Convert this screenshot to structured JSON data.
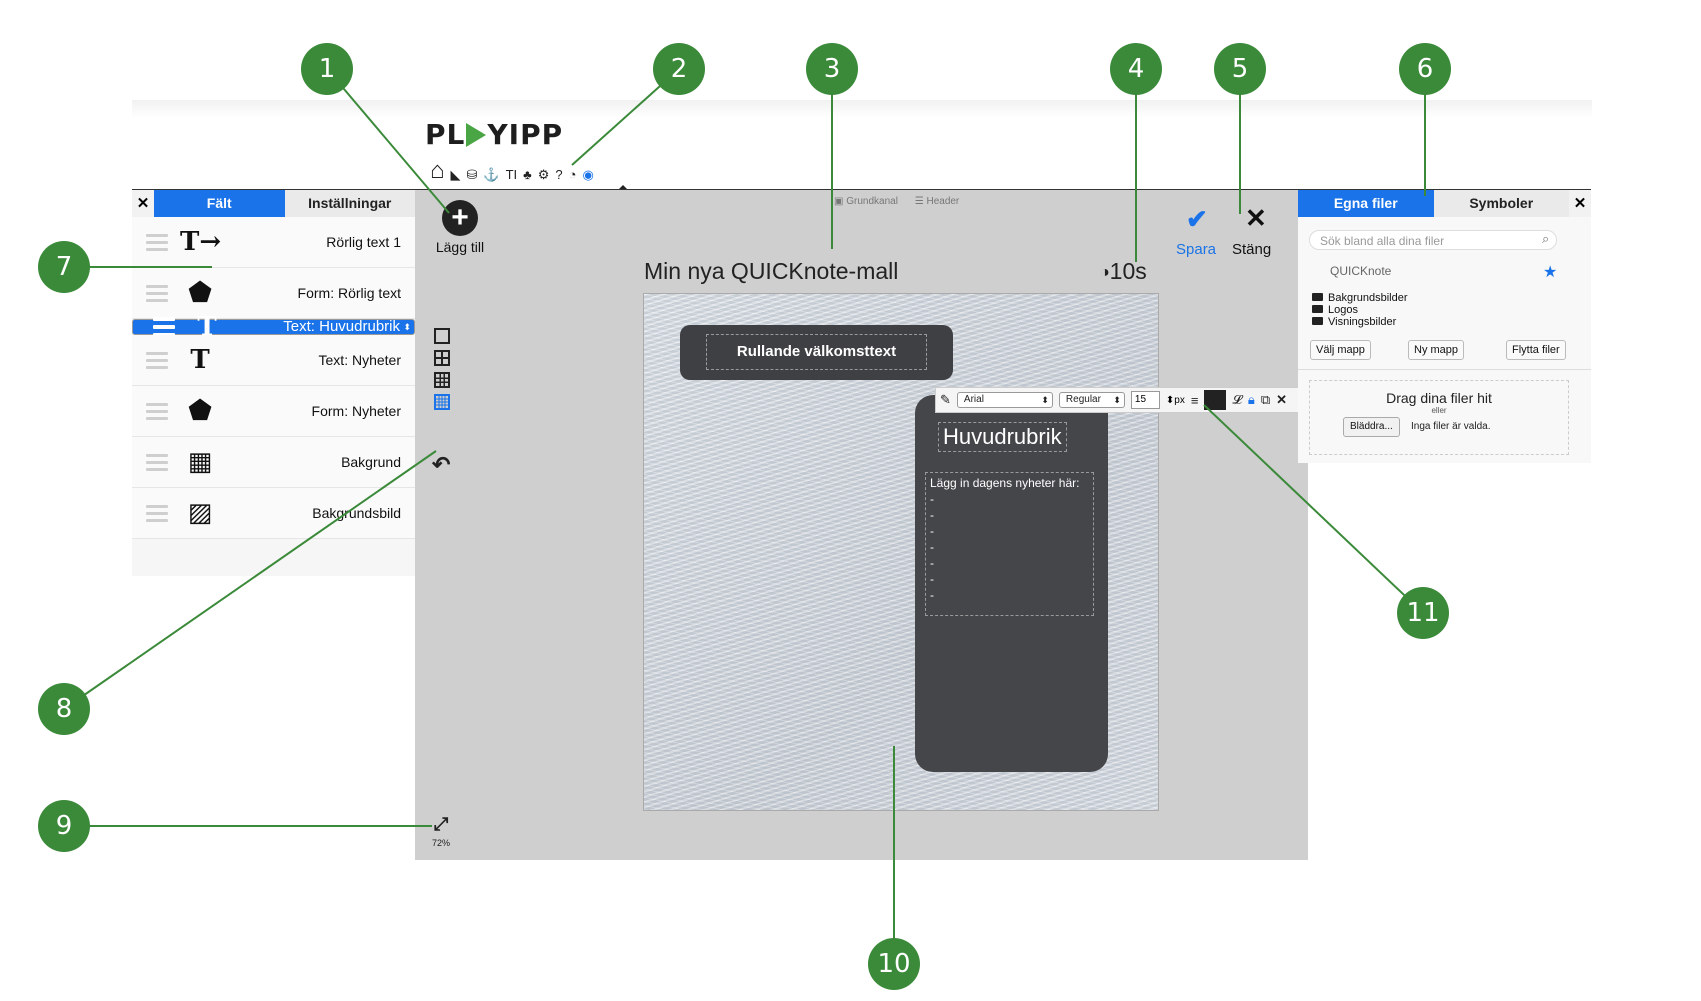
{
  "logo": {
    "left": "PL",
    "right": "YIPP"
  },
  "toolbar": {
    "add_label": "Lägg till",
    "crumb_1": "Grundkanal",
    "crumb_2": "Header",
    "template_name": "Min nya QUICKnote-mall",
    "duration": "10s",
    "save_label": "Spara",
    "close_label": "Stäng",
    "zoom": "72%"
  },
  "left_panel": {
    "close": "✕",
    "tabs": [
      {
        "label": "Fält",
        "active": true
      },
      {
        "label": "Inställningar",
        "active": false
      }
    ],
    "items": [
      {
        "label": "Rörlig text 1",
        "icon": "moving-text-icon",
        "glyph": "T→"
      },
      {
        "label": "Form: Rörlig text",
        "icon": "pentagon-icon",
        "glyph": "⬟"
      },
      {
        "label": "Text: Huvudrubrik",
        "icon": "text-icon",
        "glyph": "T",
        "selected": true
      },
      {
        "label": "Text: Nyheter",
        "icon": "text-icon",
        "glyph": "T"
      },
      {
        "label": "Form: Nyheter",
        "icon": "pentagon-icon",
        "glyph": "⬟"
      },
      {
        "label": "Bakgrund",
        "icon": "background-icon",
        "glyph": "▦"
      },
      {
        "label": "Bakgrundsbild",
        "icon": "image-icon",
        "glyph": "▨"
      }
    ]
  },
  "preview": {
    "ticker_text": "Rullande välkomsttext",
    "heading": "Huvudrubrik",
    "news_text": "Lägg in dagens nyheter här:",
    "bullets": [
      "-",
      "-",
      "-",
      "-",
      "-",
      "-",
      "-"
    ]
  },
  "format_bar": {
    "font": "Arial",
    "style": "Regular",
    "size": "15",
    "unit": "px",
    "color": "#222222"
  },
  "right_panel": {
    "tabs": [
      {
        "label": "Egna filer",
        "active": true
      },
      {
        "label": "Symboler",
        "active": false
      }
    ],
    "close": "✕",
    "search_placeholder": "Sök bland alla dina filer",
    "favorite": "QUICKnote",
    "folders": [
      "Bakgrundsbilder",
      "Logos",
      "Visningsbilder"
    ],
    "buttons": {
      "choose_folder": "Välj mapp",
      "new_folder": "Ny mapp",
      "move_files": "Flytta filer"
    },
    "drop_title": "Drag dina filer hit",
    "drop_or": "eller",
    "browse": "Bläddra...",
    "no_files": "Inga filer är valda."
  },
  "callouts": [
    "1",
    "2",
    "3",
    "4",
    "5",
    "6",
    "7",
    "8",
    "9",
    "10",
    "11"
  ],
  "colors": {
    "accent": "#1a73e8",
    "callout": "#3b8a3a",
    "logo_play": "#4aa544",
    "dark_shape": "#45464a"
  }
}
